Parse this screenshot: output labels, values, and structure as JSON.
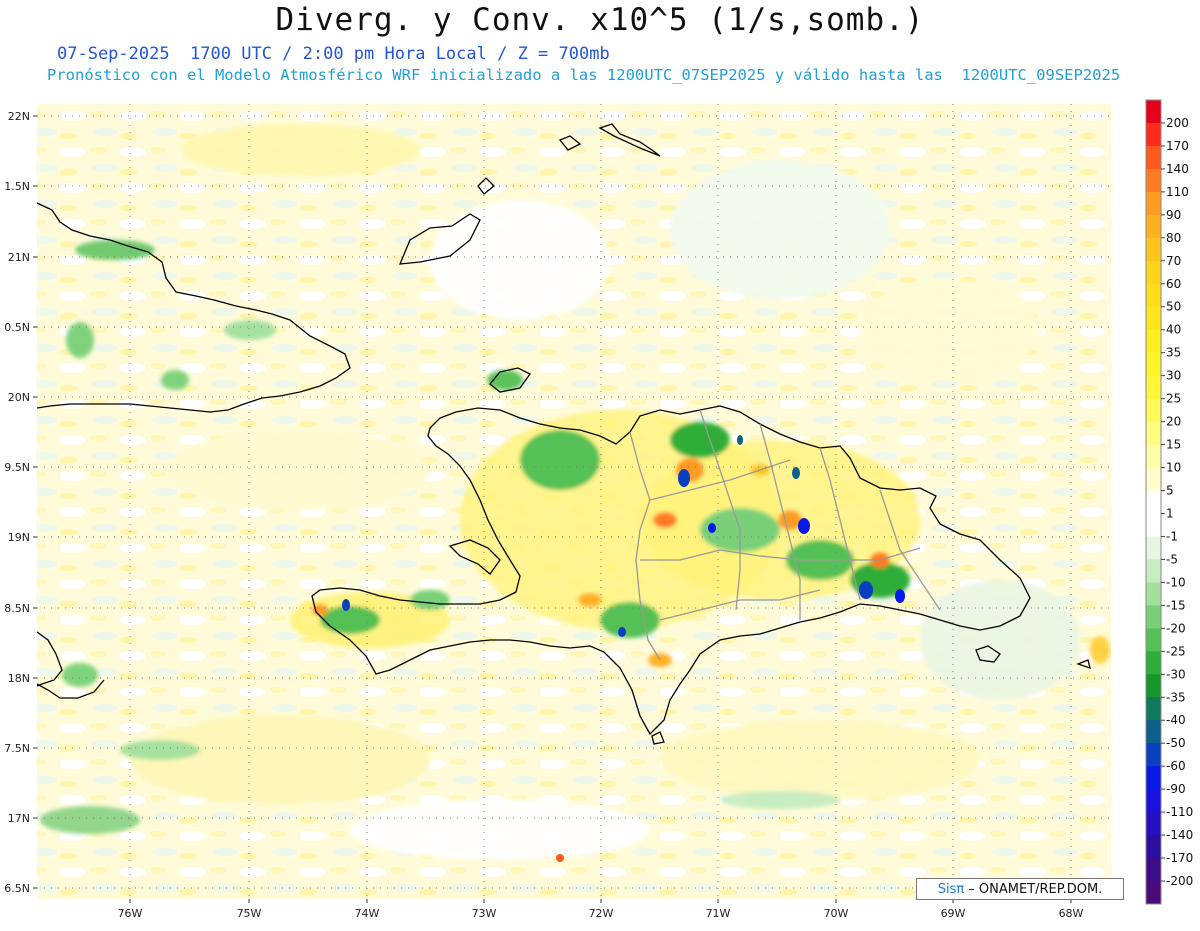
{
  "header": {
    "title": "Diverg. y Conv. x10^5 (1/s,somb.)",
    "line1": "07-Sep-2025  1700 UTC / 2:00 pm Hora Local / Z = 700mb",
    "line2": "Pronóstico con el Modelo Atmosférico WRF inicializado a las 1200UTC_07SEP2025 y válido hasta las  1200UTC_09SEP2025"
  },
  "axes": {
    "lat_labels": [
      "22N",
      "1.5N",
      "21N",
      "0.5N",
      "20N",
      "9.5N",
      "19N",
      "8.5N",
      "18N",
      "7.5N",
      "17N",
      "6.5N"
    ],
    "lon_labels": [
      "76W",
      "75W",
      "74W",
      "73W",
      "72W",
      "71W",
      "70W",
      "69W",
      "68W"
    ]
  },
  "colorbar": {
    "labels": [
      "200",
      "170",
      "140",
      "110",
      "90",
      "80",
      "70",
      "60",
      "50",
      "40",
      "35",
      "30",
      "25",
      "20",
      "15",
      "10",
      "5",
      "1",
      "-1",
      "-5",
      "-10",
      "-15",
      "-20",
      "-25",
      "-30",
      "-35",
      "-40",
      "-50",
      "-60",
      "-90",
      "-110",
      "-140",
      "-170",
      "-200"
    ],
    "colors": [
      "#e8001a",
      "#ff2a1a",
      "#ff5a1e",
      "#ff7c20",
      "#ff9a22",
      "#ffb020",
      "#ffc41e",
      "#ffd21c",
      "#ffdd1a",
      "#ffe61c",
      "#ffee20",
      "#fff226",
      "#fff63a",
      "#fffa5a",
      "#fffc80",
      "#fffda8",
      "#fffecc",
      "#ffffff",
      "#ffffff",
      "#e6f6e2",
      "#c6ecc0",
      "#a3e09c",
      "#79d078",
      "#54c055",
      "#2fae38",
      "#14962a",
      "#0f7a5a",
      "#0c5f8a",
      "#0a3fc0",
      "#0818e6",
      "#1a10e0",
      "#2410c0",
      "#2a0ea0",
      "#3c0b88",
      "#4a0a7a"
    ]
  },
  "map": {
    "land_outline_color": "#000000",
    "province_outline_color": "#999999",
    "grid_color": "#777777"
  },
  "credit": {
    "brand": "Sis",
    "pi": "π",
    "rest": " – ONAMET/REP.DOM."
  }
}
